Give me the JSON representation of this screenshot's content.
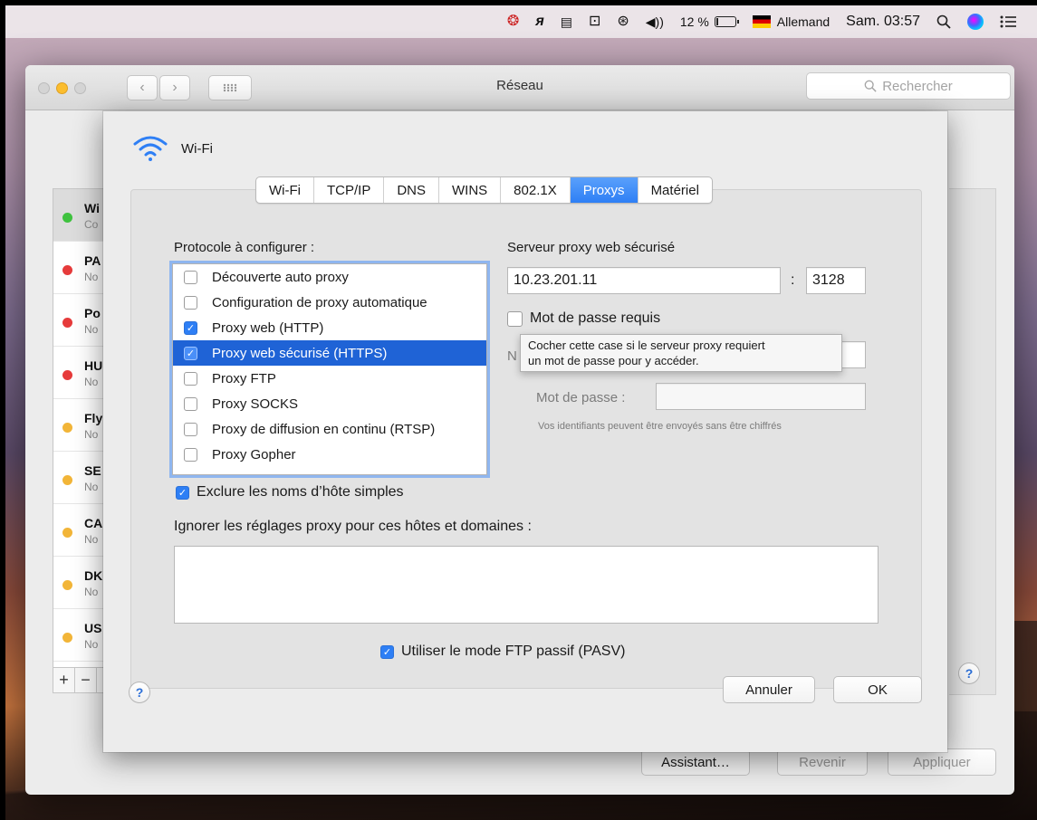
{
  "menubar": {
    "battery_percent": "12 %",
    "battery_level": 0.12,
    "keyboard_layout": "Allemand",
    "clock": "Sam. 03:57",
    "icons": [
      "creative-cloud-icon",
      "script-icon",
      "keyboard-icon",
      "airplay-icon",
      "sync-icon",
      "volume-icon",
      "battery-icon",
      "flag-germany-icon",
      "spotlight-icon",
      "siri-icon",
      "notification-center-icon"
    ]
  },
  "window": {
    "title": "Réseau",
    "search_placeholder": "Rechercher",
    "assistant_label": "Assistant…",
    "revert_label": "Revenir",
    "apply_label": "Appliquer"
  },
  "services": [
    {
      "name": "Wi",
      "status": "Co",
      "color": "#3fc23f"
    },
    {
      "name": "PA",
      "status": "No",
      "color": "#e63b3b"
    },
    {
      "name": "Po",
      "status": "No",
      "color": "#e63b3b"
    },
    {
      "name": "HU",
      "status": "No",
      "color": "#e63b3b"
    },
    {
      "name": "Fly",
      "status": "No",
      "color": "#f2b538"
    },
    {
      "name": "SE",
      "status": "No",
      "color": "#f2b538"
    },
    {
      "name": "CA",
      "status": "No",
      "color": "#f2b538"
    },
    {
      "name": "DK",
      "status": "No",
      "color": "#f2b538"
    },
    {
      "name": "US",
      "status": "No",
      "color": "#f2b538"
    }
  ],
  "sheet": {
    "interface_name": "Wi-Fi",
    "tabs": [
      "Wi-Fi",
      "TCP/IP",
      "DNS",
      "WINS",
      "802.1X",
      "Proxys",
      "Matériel"
    ],
    "active_tab": "Proxys",
    "protocol_label": "Protocole à configurer :",
    "protocols": [
      {
        "label": "Découverte auto proxy",
        "checked": false
      },
      {
        "label": "Configuration de proxy automatique",
        "checked": false
      },
      {
        "label": "Proxy web (HTTP)",
        "checked": true
      },
      {
        "label": "Proxy web sécurisé (HTTPS)",
        "checked": true
      },
      {
        "label": "Proxy FTP",
        "checked": false
      },
      {
        "label": "Proxy SOCKS",
        "checked": false
      },
      {
        "label": "Proxy de diffusion en continu (RTSP)",
        "checked": false
      },
      {
        "label": "Proxy Gopher",
        "checked": false
      }
    ],
    "selected_protocol": "Proxy web sécurisé (HTTPS)",
    "server_heading": "Serveur proxy web sécurisé",
    "server_address": "10.23.201.11",
    "port_separator": ":",
    "port": "3128",
    "password_required_label": "Mot de passe requis",
    "tooltip_line1": "Cocher cette case si le serveur proxy requiert",
    "tooltip_line2": "un mot de passe pour y accéder.",
    "username_label_partial": "N",
    "password_label": "Mot de passe :",
    "credentials_note": "Vos identifiants peuvent être envoyés sans être chiffrés",
    "exclude_simple_label": "Exclure les noms d’hôte simples",
    "bypass_label": "Ignorer les réglages proxy pour ces hôtes et domaines :",
    "bypass_value": "",
    "pasv_label": "Utiliser le mode FTP passif (PASV)",
    "cancel_label": "Annuler",
    "ok_label": "OK"
  },
  "help_glyph": "?",
  "checkmark_glyph": "✓",
  "colors": {
    "accent": "#2e7ff5",
    "selection": "#1f63d6"
  }
}
